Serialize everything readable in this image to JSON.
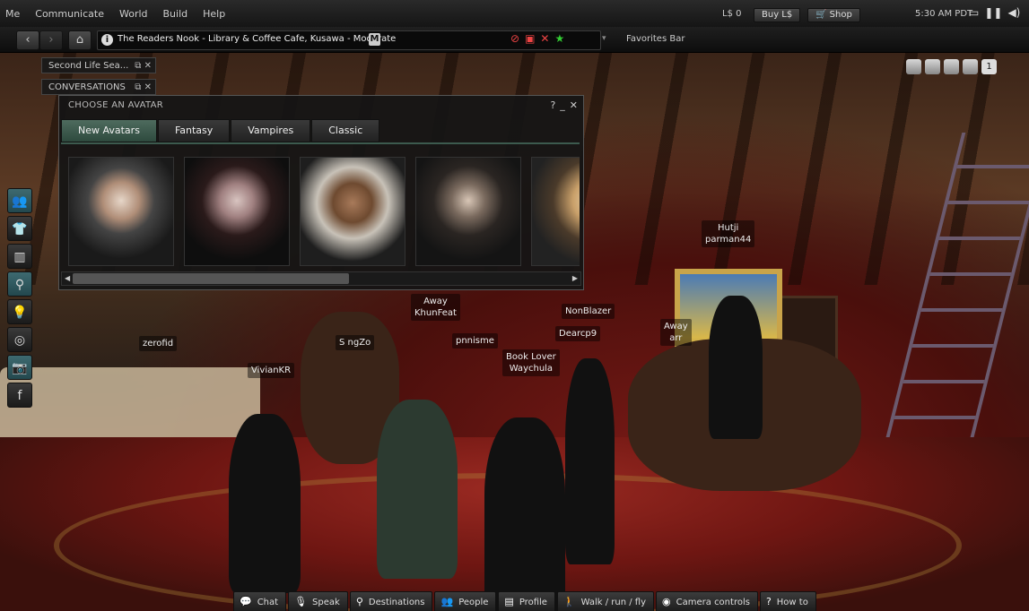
{
  "menubar": {
    "menus": [
      "Me",
      "Communicate",
      "World",
      "Build",
      "Help"
    ],
    "balance": "L$ 0",
    "buy_label": "Buy L$",
    "shop_label": "Shop",
    "clock": "5:30 AM PDT"
  },
  "navbar": {
    "location": "The Readers Nook - Library & Coffee Cafe, Kusawa - Moderate",
    "rating": "M",
    "favorites": "Favorites Bar"
  },
  "floating_tabs": [
    {
      "label": "Second Life Sea..."
    },
    {
      "label": "CONVERSATIONS"
    }
  ],
  "avatar_picker": {
    "title": "CHOOSE AN AVATAR",
    "tabs": [
      "New Avatars",
      "Fantasy",
      "Vampires",
      "Classic"
    ],
    "active_tab": "New Avatars"
  },
  "name_tags": {
    "hutji": "Hutji",
    "parman": "parman44",
    "nonblazer": "NonBlazer",
    "dearcp": "Dearcp9",
    "away1": "Away",
    "khunfeat": "KhunFeat",
    "pnnisme": "pnnisme",
    "booklover": "Book Lover",
    "waychula": "Waychula",
    "zerofid": "zerofid",
    "viviankr": "VivianKR",
    "ozo": "S    ngZo",
    "away2": "Away",
    "arr": "arr"
  },
  "camera_preset_number": "1",
  "bottombar": {
    "chat": "Chat",
    "speak": "Speak",
    "destinations": "Destinations",
    "people": "People",
    "profile": "Profile",
    "walk": "Walk / run / fly",
    "camera": "Camera controls",
    "howto": "How to"
  }
}
